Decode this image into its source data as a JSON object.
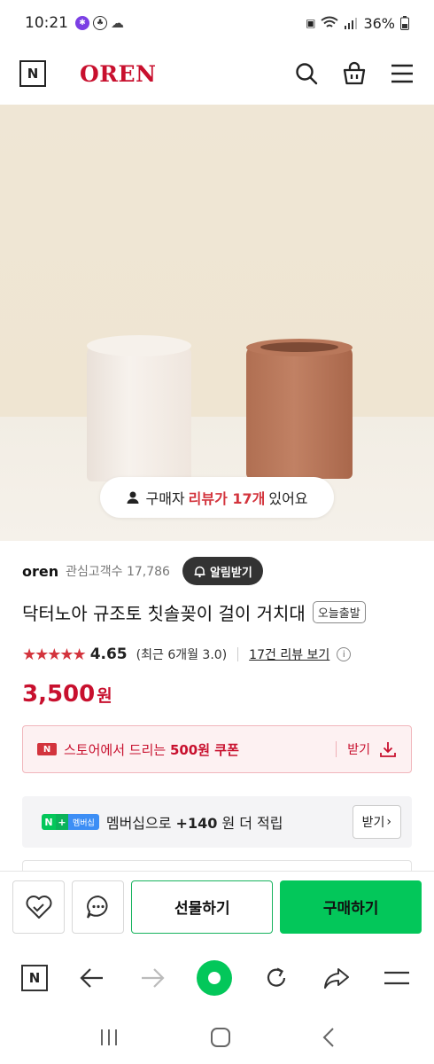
{
  "status_bar": {
    "time": "10:21",
    "battery": "36%"
  },
  "header": {
    "logo": "N",
    "brand": "OREN",
    "icons": [
      "search-icon",
      "cart-icon",
      "menu-icon"
    ]
  },
  "hero": {
    "review_prefix": "구매자",
    "review_highlight": "리뷰가 17개",
    "review_suffix": "있어요"
  },
  "store": {
    "name": "oren",
    "fav_label": "관심고객수 17,786",
    "alert_button": "알림받기"
  },
  "product": {
    "title": "닥터노아 규조토 칫솔꽂이 걸이 거치대",
    "badge": "오늘출발",
    "stars": "★★★★★",
    "rating": "4.65",
    "recent": "(최근 6개월 3.0)",
    "review_link": "17건 리뷰 보기",
    "price": "3,500",
    "currency": "원"
  },
  "coupon": {
    "badge": "N",
    "text_prefix": "스토어에서 드리는 ",
    "text_bold": "500원 쿠폰",
    "get_label": "받기"
  },
  "membership": {
    "badge_n": "N",
    "badge_plus": "+",
    "badge_label": "멤버십",
    "text_prefix": "멤버십으로 ",
    "text_bold": "+140",
    "text_suffix": "원 더 적립",
    "button": "받기",
    "button_arrow": "›"
  },
  "actions": {
    "gift": "선물하기",
    "buy": "구매하기"
  },
  "browser": {
    "logo": "N"
  },
  "colors": {
    "brand_red": "#c8102e",
    "naver_green": "#03c75a"
  }
}
